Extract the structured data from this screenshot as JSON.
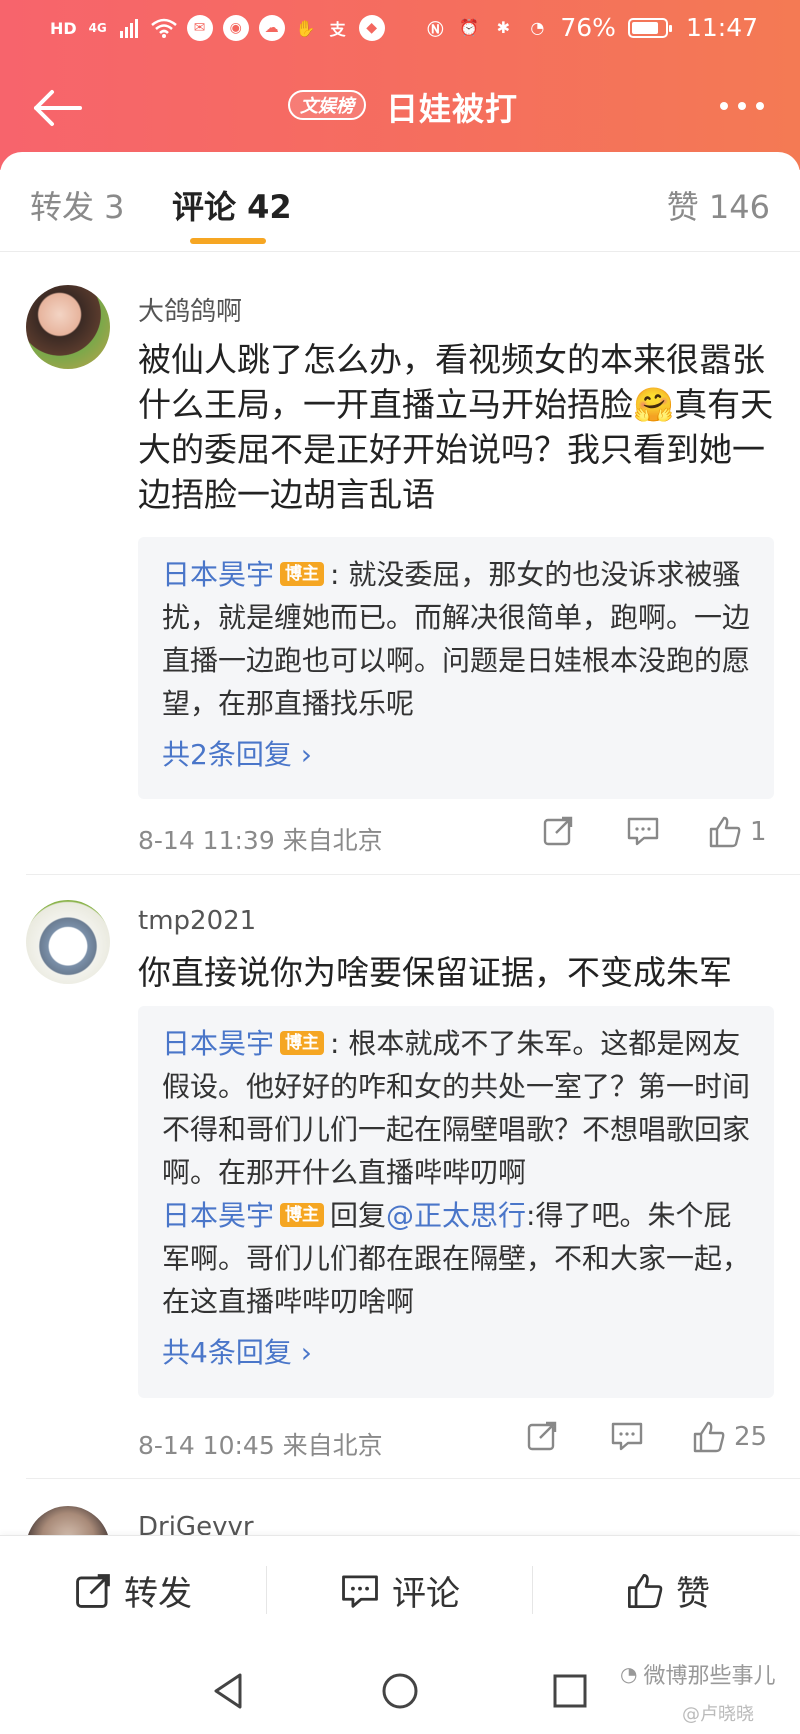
{
  "status_bar": {
    "left_icons": [
      "HD",
      "4G",
      "signal-icon",
      "wifi-icon",
      "message-icon",
      "weibo-icon",
      "cloud-icon",
      "hand-icon",
      "支",
      "browser-icon"
    ],
    "hd": "HD",
    "network": "4G",
    "alipay_char": "支",
    "battery_pct": "76%",
    "time": "11:47"
  },
  "nav": {
    "badge": "文娱榜",
    "title": "日娃被打"
  },
  "tabs": {
    "repost": "转发 3",
    "comment": "评论 42",
    "like": "赞 146"
  },
  "comments": [
    {
      "user": "大鸽鸽啊",
      "text": "被仙人跳了怎么办，看视频女的本来很嚣张什么王局，一开直播立马开始捂脸🤗真有天大的委屈不是正好开始说吗？我只看到她一边捂脸一边胡言乱语",
      "replies": [
        {
          "name": "日本昊宇",
          "badge": "博主",
          "sep": ":",
          "text": "就没委屈，那女的也没诉求被骚扰，就是缠她而已。而解决很简单，跑啊。一边直播一边跑也可以啊。问题是日娃根本没跑的愿望，在那直播找乐呢"
        }
      ],
      "more_replies": "共2条回复 ›",
      "meta": "8-14 11:39  来自北京",
      "likes": "1"
    },
    {
      "user": "tmp2021",
      "text": "你直接说你为啥要保留证据，不变成朱军",
      "replies": [
        {
          "name": "日本昊宇",
          "badge": "博主",
          "sep": ":",
          "text": "根本就成不了朱军。这都是网友假设。他好好的咋和女的共处一室了？第一时间不得和哥们儿们一起在隔壁唱歌？不想唱歌回家啊。在那开什么直播哔哔叨啊"
        },
        {
          "name": "日本昊宇",
          "badge": "博主",
          "sep": "回复",
          "mention": "@正太思行",
          "text": ":得了吧。朱个屁军啊。哥们儿们都在跟在隔壁，不和大家一起，在这直播哔哔叨啥啊"
        }
      ],
      "more_replies": "共4条回复 ›",
      "meta": "8-14 10:45  来自北京",
      "likes": "25"
    },
    {
      "user": "DriGevvr"
    }
  ],
  "bottom_bar": {
    "repost": "转发",
    "comment": "评论",
    "like": "赞"
  },
  "watermark": {
    "text": "微博那些事儿",
    "sub": "@卢晓晓"
  },
  "colors": {
    "header_gradient_start": "#f7646c",
    "header_gradient_end": "#f47a54",
    "link_blue": "#4a76c9",
    "badge_orange": "#f5a623",
    "tab_underline": "#f6a623"
  }
}
